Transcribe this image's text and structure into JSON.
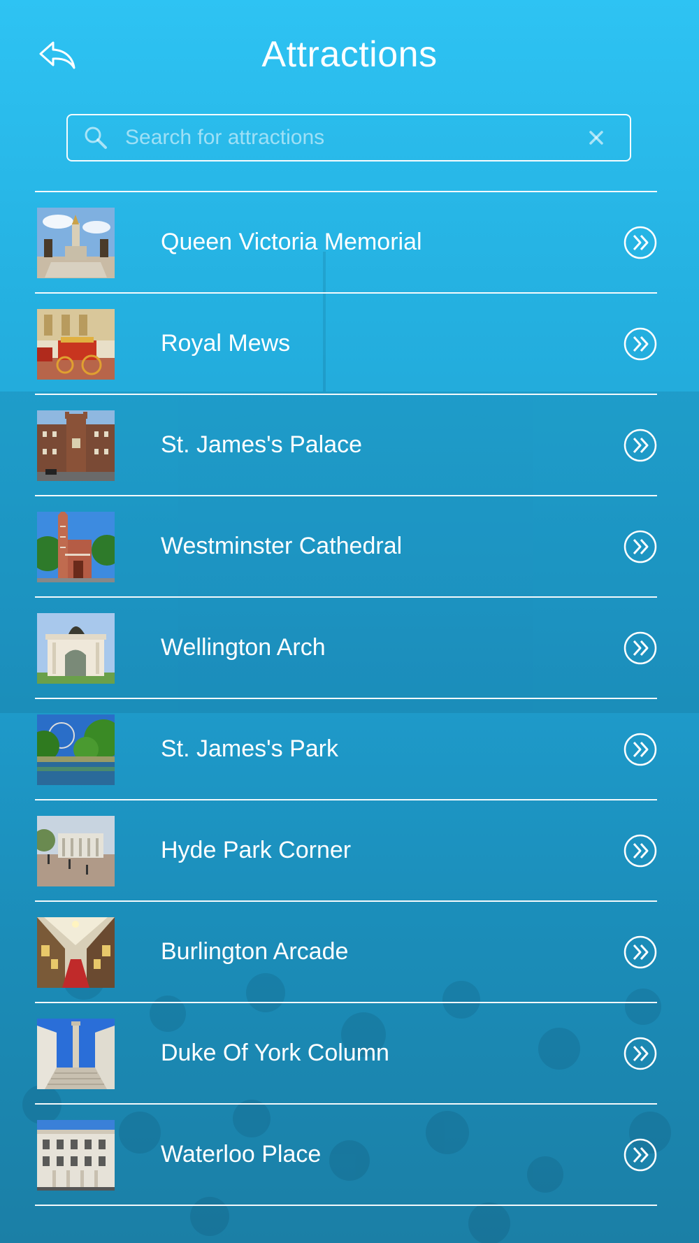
{
  "header": {
    "title": "Attractions",
    "back_icon": "back-reply-arrow-icon"
  },
  "search": {
    "placeholder": "Search for attractions",
    "value": "",
    "search_icon": "magnifier-icon",
    "clear_icon": "clear-x-icon"
  },
  "attractions": [
    {
      "name": "Queen Victoria Memorial",
      "thumb_icon": "memorial-photo"
    },
    {
      "name": "Royal Mews",
      "thumb_icon": "carriage-photo"
    },
    {
      "name": "St. James's Palace",
      "thumb_icon": "palace-photo"
    },
    {
      "name": "Westminster Cathedral",
      "thumb_icon": "cathedral-photo"
    },
    {
      "name": "Wellington Arch",
      "thumb_icon": "arch-photo"
    },
    {
      "name": "St. James's Park",
      "thumb_icon": "park-photo"
    },
    {
      "name": "Hyde Park Corner",
      "thumb_icon": "gate-photo"
    },
    {
      "name": "Burlington Arcade",
      "thumb_icon": "arcade-photo"
    },
    {
      "name": "Duke Of York Column",
      "thumb_icon": "column-photo"
    },
    {
      "name": "Waterloo Place",
      "thumb_icon": "building-photo"
    }
  ],
  "row_arrow_icon": "double-chevron-circle-icon",
  "colors": {
    "accent": "#2ec3f3",
    "text": "#ffffff"
  }
}
